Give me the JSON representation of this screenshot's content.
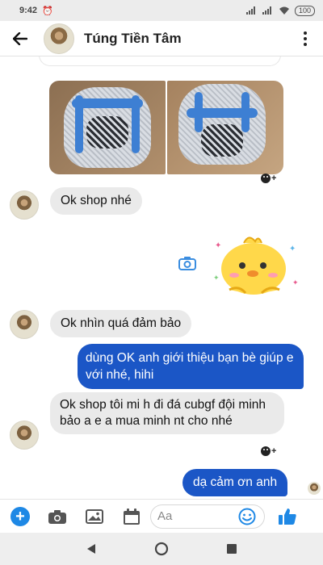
{
  "status_bar": {
    "time": "9:42",
    "battery": "100"
  },
  "header": {
    "contact_name": "Túng Tiền Tâm"
  },
  "messages": [
    {
      "side": "in",
      "text": "Ok shop nhé"
    },
    {
      "side": "in",
      "text": "Ok nhìn quá đảm bảo"
    },
    {
      "side": "out",
      "text": "dùng OK anh giới thiệu bạn bè giúp e với nhé, hihi"
    },
    {
      "side": "in",
      "text": "Ok shop tôi mi h đi đá cubgf đội minh bảo a e a mua minh nt cho nhé"
    },
    {
      "side": "out",
      "text": "dạ cảm ơn anh"
    }
  ],
  "composer": {
    "placeholder": "Aa"
  },
  "colors": {
    "outgoing_bubble": "#1b56c6",
    "incoming_bubble": "#eaeaea",
    "accent": "#1e88e5"
  },
  "icons": [
    "back-arrow-icon",
    "more-options-icon",
    "camera-icon",
    "react-emoji-icon",
    "add-icon",
    "photo-icon",
    "gallery-icon",
    "calendar-icon",
    "emoji-icon",
    "like-icon",
    "nav-back-icon",
    "nav-home-icon",
    "nav-recents-icon",
    "sticker-image"
  ]
}
